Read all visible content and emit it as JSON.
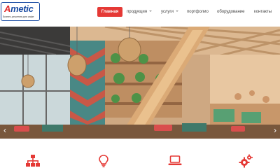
{
  "brand": {
    "name_part1": "A",
    "name_part2": "metic",
    "tagline": "Бизнес-решения для кафе"
  },
  "nav": {
    "items": [
      {
        "label": "Главная",
        "active": true
      },
      {
        "label": "продукция",
        "has_dropdown": true
      },
      {
        "label": "услуги",
        "has_dropdown": true
      },
      {
        "label": "портфолио"
      },
      {
        "label": "оборудование"
      },
      {
        "label": "контакты"
      }
    ]
  },
  "slider": {
    "prev_label": "‹",
    "next_label": "›"
  },
  "features": {
    "accent_color": "#e53935",
    "icons": [
      "org-structure-icon",
      "lightbulb-icon",
      "laptop-icon",
      "gears-icon"
    ]
  },
  "colors": {
    "accent": "#e53935",
    "brand_blue": "#1b4da3"
  }
}
